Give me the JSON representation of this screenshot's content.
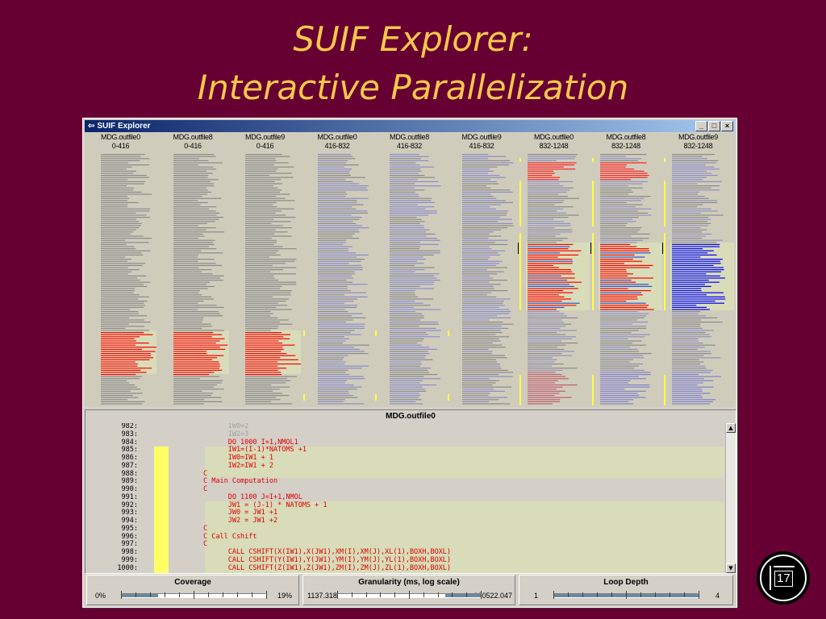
{
  "slide": {
    "title_line1": "SUIF Explorer:",
    "title_line2": "Interactive Parallelization",
    "page_number": "17"
  },
  "window": {
    "title": "SUIF Explorer",
    "controls": [
      "_",
      "□",
      "×"
    ]
  },
  "columns": [
    {
      "file": "MDG.outfile0",
      "range": "0-416"
    },
    {
      "file": "MDG.outfile8",
      "range": "0-416"
    },
    {
      "file": "MDG.outfile9",
      "range": "0-416"
    },
    {
      "file": "MDG.outfile0",
      "range": "416-832"
    },
    {
      "file": "MDG.outfile8",
      "range": "416-832"
    },
    {
      "file": "MDG.outfile9",
      "range": "416-832"
    },
    {
      "file": "MDG.outfile0",
      "range": "832-1248"
    },
    {
      "file": "MDG.outfile8",
      "range": "832-1248"
    },
    {
      "file": "MDG.outfile9",
      "range": "832-1248"
    }
  ],
  "code_view": {
    "title": "MDG.outfile0",
    "lines": [
      {
        "num": "982:",
        "text": "      IW0=2",
        "style": "gray"
      },
      {
        "num": "983:",
        "text": "      IW2=3",
        "style": "gray"
      },
      {
        "num": "984:",
        "text": "      DO 1000 I=1,NMOL1",
        "style": "red"
      },
      {
        "num": "985:",
        "text": "      IW1=(I-1)*NATOMS +1",
        "style": "red"
      },
      {
        "num": "986:",
        "text": "      IW0=IW1 + 1",
        "style": "red"
      },
      {
        "num": "987:",
        "text": "      IW2=IW1 + 2",
        "style": "red"
      },
      {
        "num": "988:",
        "text": "C",
        "style": "red"
      },
      {
        "num": "989:",
        "text": "C Main Computation",
        "style": "red"
      },
      {
        "num": "990:",
        "text": "C",
        "style": "red"
      },
      {
        "num": "991:",
        "text": "      DO 1100 J=I+1,NMOL",
        "style": "red"
      },
      {
        "num": "992:",
        "text": "      JW1 = (J-1) * NATOMS + 1",
        "style": "red"
      },
      {
        "num": "993:",
        "text": "      JW0 = JW1 +1",
        "style": "red"
      },
      {
        "num": "994:",
        "text": "      JW2 = JW1 +2",
        "style": "red"
      },
      {
        "num": "995:",
        "text": "C",
        "style": "red"
      },
      {
        "num": "996:",
        "text": "C Call Cshift",
        "style": "red"
      },
      {
        "num": "997:",
        "text": "C",
        "style": "red"
      },
      {
        "num": "998:",
        "text": "      CALL CSHIFT(X(IW1),X(JW1),XM(I),XM(J),XL(1),BOXH,BOXL)",
        "style": "red"
      },
      {
        "num": "999:",
        "text": "      CALL CSHIFT(Y(IW1),Y(JW1),YM(I),YM(J),YL(1),BOXH,BOXL)",
        "style": "red"
      },
      {
        "num": "1000:",
        "text": "      CALL CSHIFT(Z(IW1),Z(JW1),ZM(I),ZM(J),ZL(1),BOXH,BOXL)",
        "style": "red"
      }
    ]
  },
  "controls": {
    "coverage": {
      "label": "Coverage",
      "min": "0%",
      "max": "19%",
      "selected_fraction": [
        0.0,
        0.25
      ]
    },
    "granularity": {
      "label": "Granularity (ms, log scale)",
      "min": "1137.318",
      "max": "160522.047",
      "selected_fraction": [
        0.75,
        1.0
      ]
    },
    "loop_depth": {
      "label": "Loop Depth",
      "min": "1",
      "max": "4",
      "selected_fraction": [
        0.0,
        1.0
      ]
    }
  },
  "colors": {
    "background": "#660033",
    "title": "#f9c84a",
    "parallel": "#ff0000",
    "selected": "#0000ff",
    "gray_bars": "#8a8a8a",
    "highlight": "#d8dcb8",
    "coverage_marker": "#ffff66"
  }
}
